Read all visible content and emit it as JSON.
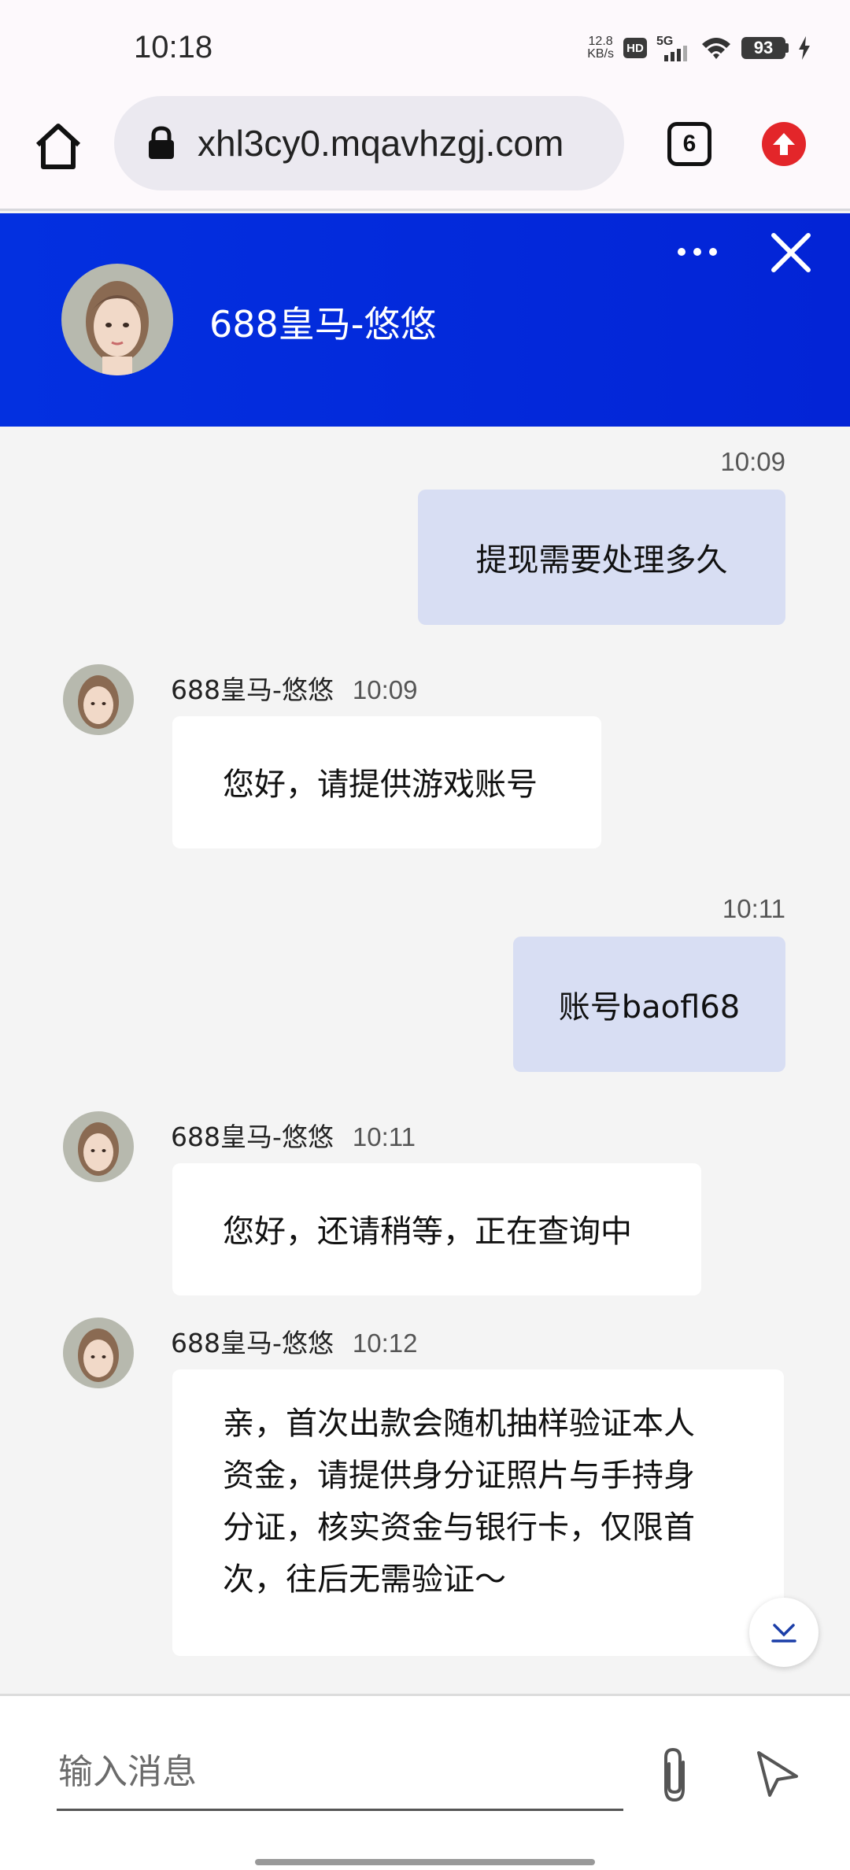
{
  "status_bar": {
    "time": "10:18",
    "speed_value": "12.8",
    "speed_unit": "KB/s",
    "hd": "HD",
    "network": "5G",
    "battery": "93"
  },
  "browser": {
    "url": "xhl3cy0.mqavhzgj.com",
    "tab_count": "6"
  },
  "chat_header": {
    "agent_name": "688皇马-悠悠"
  },
  "messages": [
    {
      "direction": "out",
      "time": "10:09",
      "text": "提现需要处理多久"
    },
    {
      "direction": "in",
      "sender": "688皇马-悠悠",
      "time": "10:09",
      "text": "您好，请提供游戏账号"
    },
    {
      "direction": "out",
      "time": "10:11",
      "text": "账号baofl68"
    },
    {
      "direction": "in",
      "sender": "688皇马-悠悠",
      "time": "10:11",
      "text": "您好，还请稍等，正在查询中"
    },
    {
      "direction": "in",
      "sender": "688皇马-悠悠",
      "time": "10:12",
      "lines": [
        "亲，首次出款会随机抽样验证本人",
        "资金，请提供身分证照片与手持身",
        "分证，核实资金与银行卡，仅限首",
        "次，往后无需验证～"
      ]
    }
  ],
  "input": {
    "placeholder": "输入消息"
  },
  "colors": {
    "header_blue": "#0330e0",
    "outgoing_bubble": "#d8def3",
    "incoming_bubble": "#ffffff"
  }
}
